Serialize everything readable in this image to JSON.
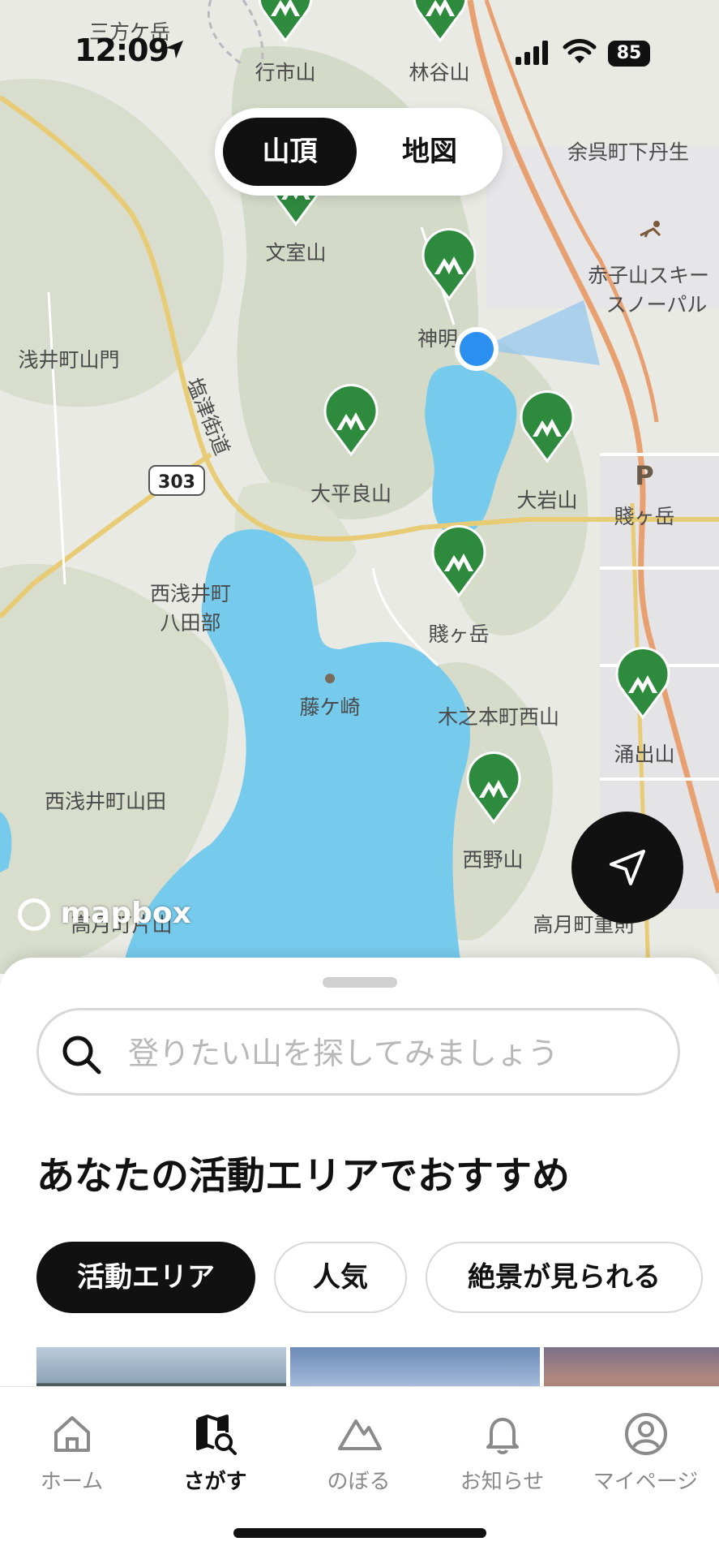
{
  "status_bar": {
    "time": "12:09",
    "battery": "85"
  },
  "map": {
    "segmented": {
      "summit_label": "山頂",
      "map_label": "地図"
    },
    "labels": {
      "sankata": "三方ケ岳",
      "gyoichi": "行市山",
      "rinya": "林谷山",
      "yogo_shimo": "余呉町下丹生",
      "bunshitsu": "文室山",
      "akago_ski": "赤子山スキー",
      "snow_pal": "スノーパル",
      "asai_yamakado": "浅井町山門",
      "shiotsu_kaido": "塩津街道",
      "shinmei": "神明",
      "road_303": "303",
      "taihira": "大平良山",
      "oiwa": "大岩山",
      "shizugatake_east": "賤ヶ岳",
      "nishiasai_hatabe_1": "西浅井町",
      "nishiasai_hatabe_2": "八田部",
      "shizugatake": "賤ヶ岳",
      "fujigasaki": "藤ケ崎",
      "kinomoto_nishiyama": "木之本町西山",
      "yudesan": "涌出山",
      "nishiasai_yamada": "西浅井町山田",
      "nishino": "西野山",
      "takatsuki_sato": "高月町重則",
      "takatsuki_left": "高月町片山",
      "mapbox": "mapbox",
      "parking": "P"
    }
  },
  "sheet": {
    "search_placeholder": "登りたい山を探してみましょう",
    "heading": "あなたの活動エリアでおすすめ",
    "chips": [
      "活動エリア",
      "人気",
      "絶景が見られる"
    ]
  },
  "tabs": [
    {
      "label": "ホーム",
      "icon": "home-icon"
    },
    {
      "label": "さがす",
      "icon": "map-search-icon"
    },
    {
      "label": "のぼる",
      "icon": "mountain-icon"
    },
    {
      "label": "お知らせ",
      "icon": "bell-icon"
    },
    {
      "label": "マイページ",
      "icon": "profile-icon"
    }
  ],
  "colors": {
    "water": "#76cbed",
    "land": "#e9eae3",
    "forest": "#d6ddca",
    "pin": "#2e8b3e",
    "road_major": "#e8a070",
    "road_minor": "#e8cc75"
  }
}
